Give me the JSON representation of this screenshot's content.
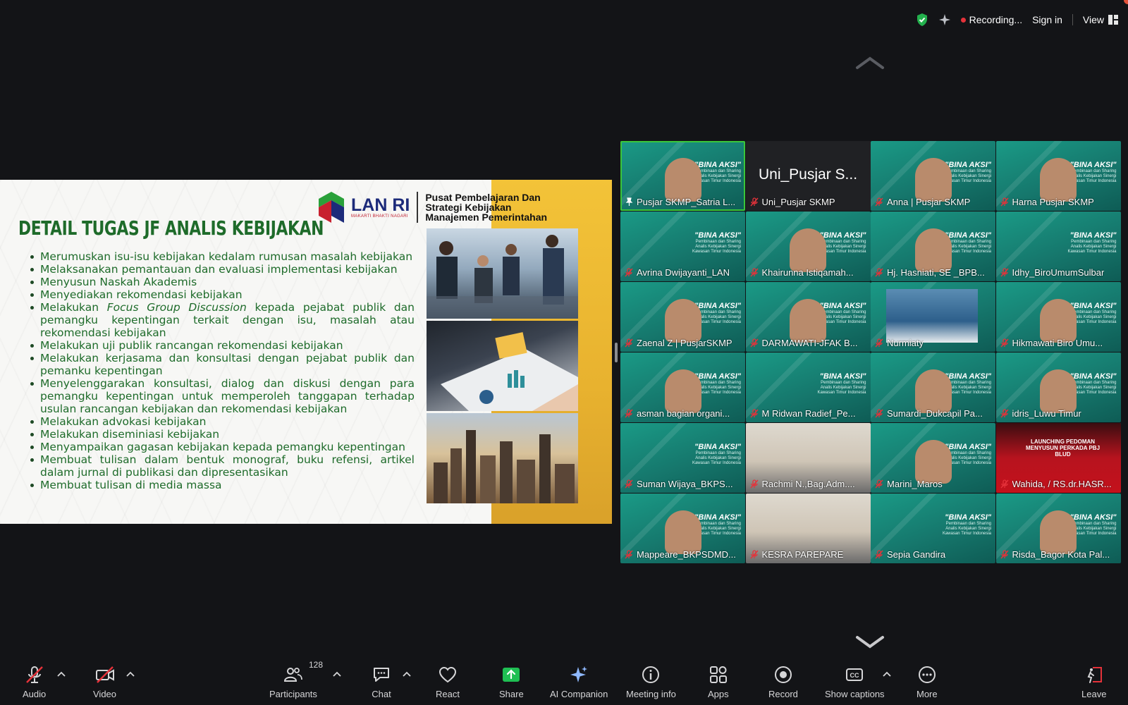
{
  "topbar": {
    "recording_label": "Recording...",
    "sign_in_label": "Sign in",
    "view_label": "View"
  },
  "slide": {
    "logo_text": "LAN RI",
    "logo_sub": "MAKARTI BHAKTI NAGARI",
    "org_line1": "Pusat Pembelajaran Dan",
    "org_line2": "Strategi Kebijakan",
    "org_line3": "Manajemen Pemerintahan",
    "title": "DETAIL TUGAS JF ANALIS KEBIJAKAN",
    "bullets": [
      "Merumuskan isu-isu kebijakan kedalam rumusan masalah kebijakan",
      "Melaksanakan pemantauan dan evaluasi implementasi kebijakan",
      "Menyusun Naskah Akademis",
      "Menyediakan rekomendasi kebijakan",
      "kepada pejabat publik dan pemangku kepentingan terkait dengan isu, masalah atau rekomendasi kebijakan",
      "Melakukan uji publik rancangan rekomendasi kebijakan",
      "Melakukan kerjasama dan konsultasi dengan pejabat publik dan pemanku kepentingan",
      "Menyelenggarakan konsultasi, dialog dan diskusi dengan para pemangku kepentingan untuk memperoleh tanggapan terhadap usulan rancangan kebijakan dan rekomendasi kebijakan",
      "Melakukan advokasi kebijakan",
      "Melakukan diseminiasi kebijakan",
      "Menyampaikan gagasan kebijakan kepada pemangku kepentingan",
      "Membuat tulisan dalam bentuk monograf, buku refensi, artikel dalam jurnal di publikasi dan dipresentasikan",
      "Membuat tulisan di media massa"
    ],
    "bullet5_prefix": "Melakukan",
    "bullet5_italic": "Focus Group Discussion"
  },
  "background": {
    "bina_title": "\"BINA AKSI\"",
    "bina_sub1": "Pembinaan dan Sharing",
    "bina_sub2": "Analis Kebijakan Sinergi",
    "bina_sub3": "Kawasan Timur Indonesia",
    "launching": "LAUNCHING PEDOMAN MENYUSUN PERKADA PBJ BLUD"
  },
  "participants": [
    {
      "name": "Pusjar SKMP_Satria L...",
      "type": "green",
      "active": true,
      "pinned": true
    },
    {
      "name": "Uni_Pusjar SKMP",
      "type": "dark",
      "big": "Uni_Pusjar S..."
    },
    {
      "name": "Anna | Pusjar SKMP",
      "type": "green"
    },
    {
      "name": "Harna Pusjar SKMP",
      "type": "green"
    },
    {
      "name": "Avrina Dwijayanti_LAN",
      "type": "green"
    },
    {
      "name": "Khairunna Istiqamah...",
      "type": "green"
    },
    {
      "name": "Hj. Hasniati, SE _BPB...",
      "type": "green"
    },
    {
      "name": "Idhy_BiroUmumSulbar",
      "type": "green"
    },
    {
      "name": "Zaenal Z | PusjarSKMP",
      "type": "green"
    },
    {
      "name": "DARMAWATI-JFAK B...",
      "type": "green"
    },
    {
      "name": "Nurmiaty",
      "type": "screen"
    },
    {
      "name": "Hikmawati Biro Umu...",
      "type": "green"
    },
    {
      "name": "asman bagian organi...",
      "type": "green"
    },
    {
      "name": "M Ridwan Radief_Pe...",
      "type": "green"
    },
    {
      "name": "Sumardi_Dukcapil Pa...",
      "type": "green"
    },
    {
      "name": "idris_Luwu Timur",
      "type": "green"
    },
    {
      "name": "Suman Wijaya_BKPS...",
      "type": "green"
    },
    {
      "name": "Rachmi N.,Bag.Adm....",
      "type": "photo"
    },
    {
      "name": "Marini_Maros",
      "type": "green"
    },
    {
      "name": "Wahida, / RS.dr.HASR...",
      "type": "red"
    },
    {
      "name": "Mappeare_BKPSDMD...",
      "type": "green"
    },
    {
      "name": "KESRA PAREPARE",
      "type": "photo"
    },
    {
      "name": "Sepia Gandira",
      "type": "green"
    },
    {
      "name": "Risda_Bagor Kota Pal...",
      "type": "green"
    }
  ],
  "toolbar": {
    "audio": "Audio",
    "video": "Video",
    "participants": "Participants",
    "participants_count": "128",
    "chat": "Chat",
    "react": "React",
    "share": "Share",
    "ai_companion": "AI Companion",
    "meeting_info": "Meeting info",
    "apps": "Apps",
    "record": "Record",
    "show_captions": "Show captions",
    "more": "More",
    "leave": "Leave"
  },
  "colors": {
    "background": "#131417",
    "share_green": "#1fbf53",
    "active_speaker": "#3ac63a",
    "mute_red": "#e5323a",
    "slide_title_green": "#1e6b2a"
  }
}
